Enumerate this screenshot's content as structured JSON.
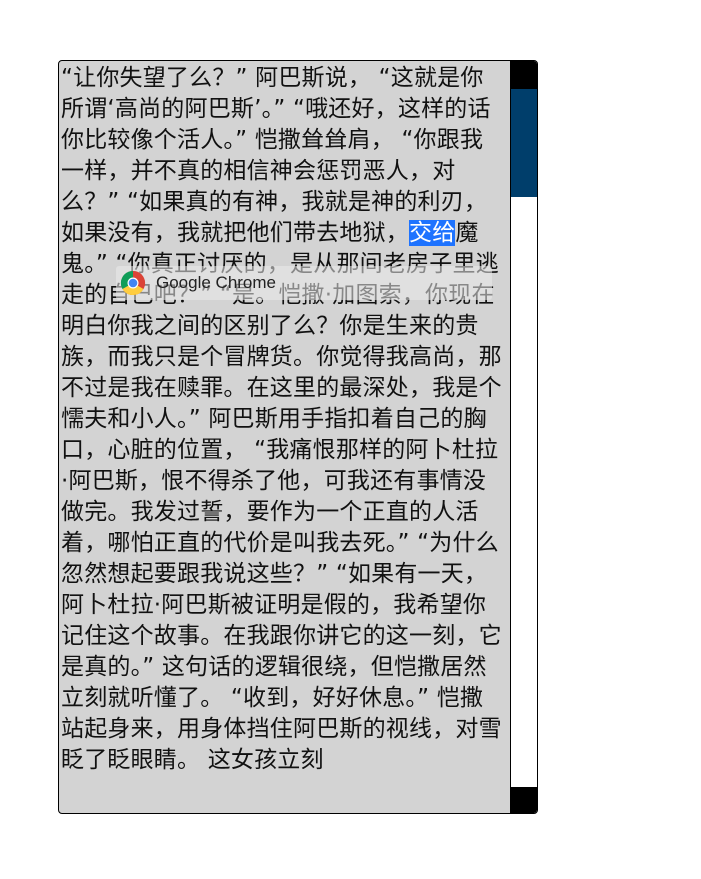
{
  "reader": {
    "text_before_highlight": "“让你失望了么？” 阿巴斯说， “这就是你所谓‘高尚的阿巴斯’。” “哦还好，这样的话你比较像个活人。” 恺撒耸耸肩， “你跟我一样，并不真的相信神会惩罚恶人，对么？” “如果真的有神，我就是神的利刃，如果没有，我就把他们带去地狱，",
    "highlighted": "交给",
    "text_after_highlight": "魔鬼。” “你真正讨厌的，是从那间老房子里逃走的自己吧？” “是。恺撒·加图索，你现在明白你我之间的区别了么？你是生来的贵族，而我只是个冒牌货。你觉得我高尚，那不过是我在赎罪。在这里的最深处，我是个懦夫和小人。” 阿巴斯用手指扣着自己的胸口，心脏的位置， “我痛恨那样的阿卜杜拉·阿巴斯，恨不得杀了他，可我还有事情没做完。我发过誓，要作为一个正直的人活着，哪怕正直的代价是叫我去死。” “为什么忽然想起要跟我说这些？” “如果有一天，阿卜杜拉·阿巴斯被证明是假的，我希望你记住这个故事。在我跟你讲它的这一刻，它是真的。” 这句话的逻辑很绕，但恺撒居然立刻就听懂了。 “收到，好好休息。” 恺撒站起身来，用身体挡住阿巴斯的视线，对雪眨了眨眼睛。 这女孩立刻"
  },
  "tooltip": {
    "label": "Google Chrome",
    "icon": "chrome-icon"
  },
  "colors": {
    "page_bg": "#d3d3d3",
    "highlight": "#1e73ff",
    "scroll_thumb": "#003e6b"
  }
}
